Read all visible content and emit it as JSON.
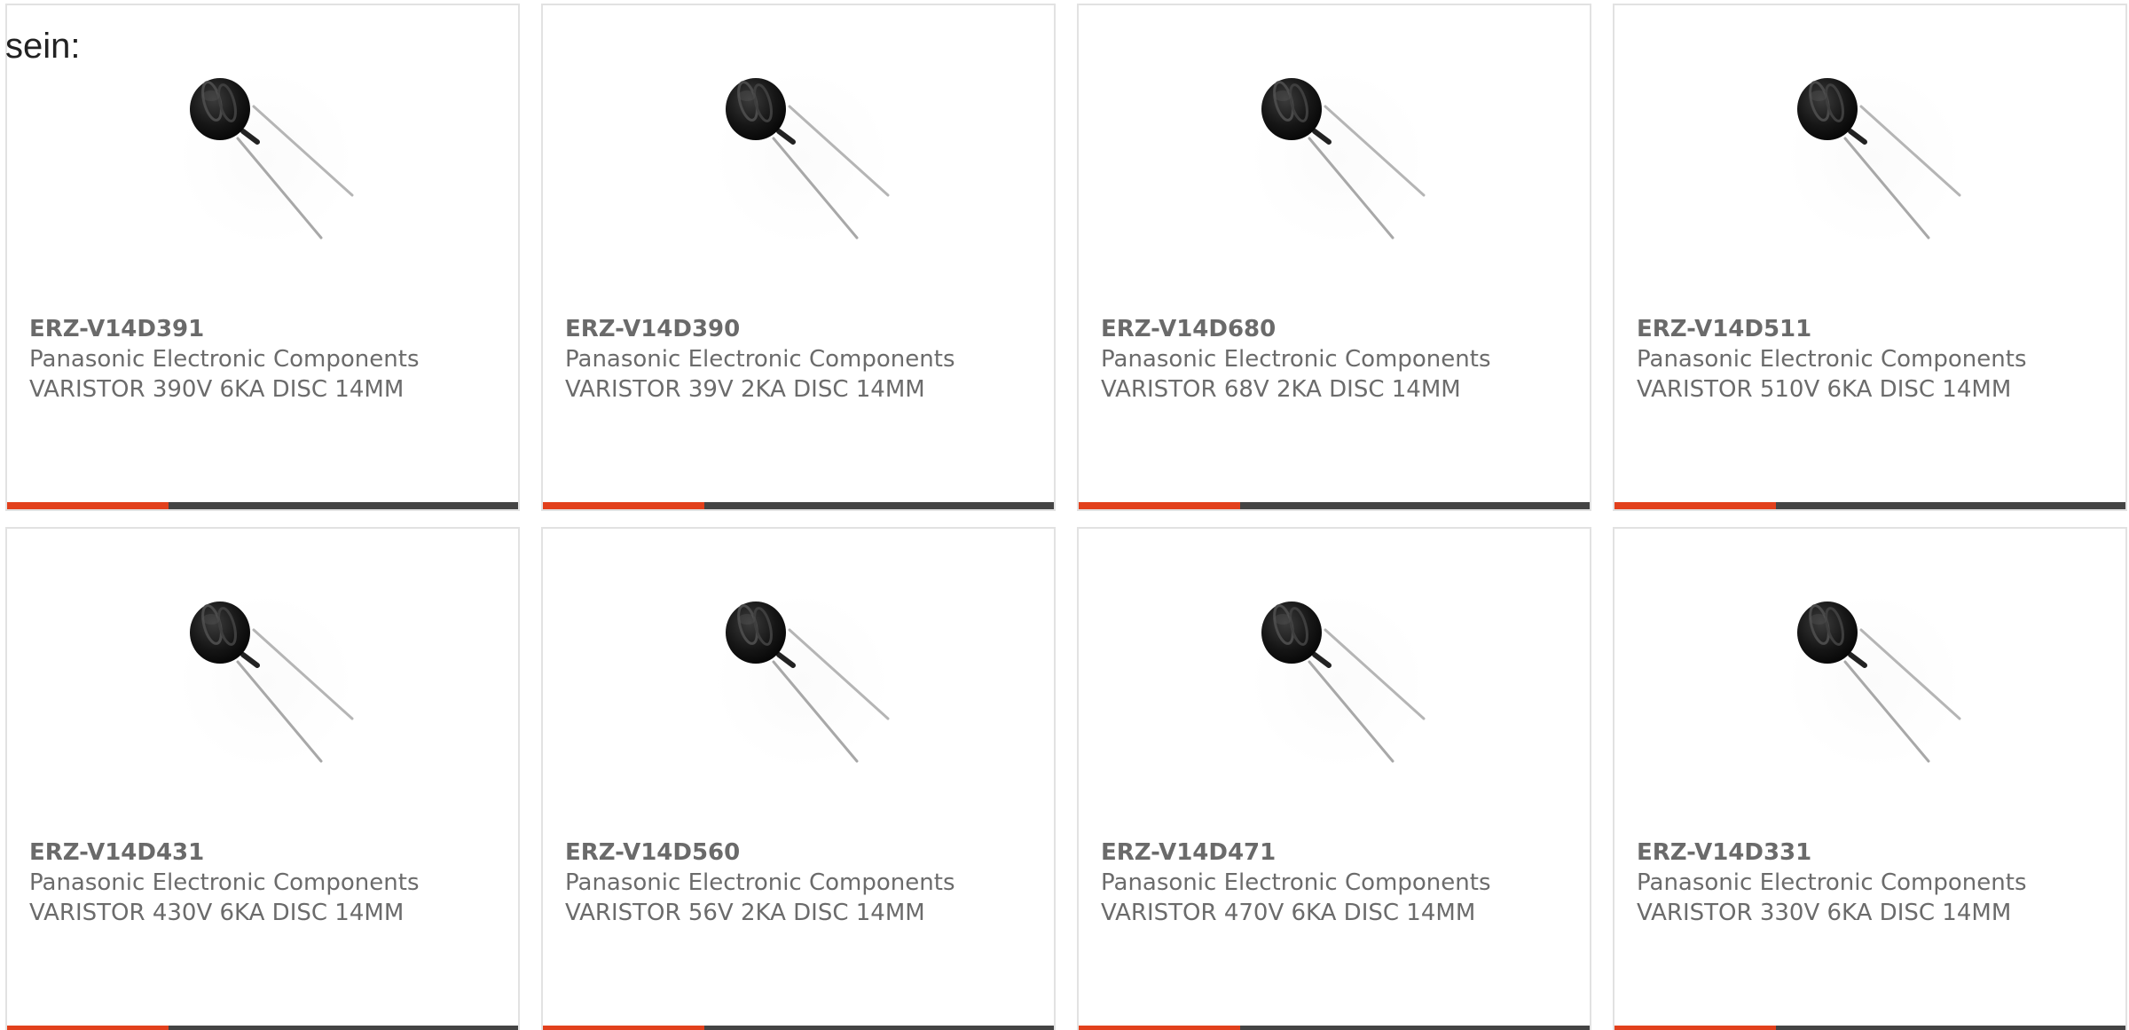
{
  "lead_text": "sein:",
  "colors": {
    "accent": "#e2401c",
    "bar": "#444444",
    "border": "#e2e2e2",
    "text": "#6b6b6b"
  },
  "products": [
    {
      "part_number": "ERZ-V14D391",
      "manufacturer": "Panasonic Electronic Components",
      "description": "VARISTOR 390V 6KA DISC 14MM",
      "image_icon": "disc-varistor-image"
    },
    {
      "part_number": "ERZ-V14D390",
      "manufacturer": "Panasonic Electronic Components",
      "description": "VARISTOR 39V 2KA DISC 14MM",
      "image_icon": "disc-varistor-image"
    },
    {
      "part_number": "ERZ-V14D680",
      "manufacturer": "Panasonic Electronic Components",
      "description": "VARISTOR 68V 2KA DISC 14MM",
      "image_icon": "disc-varistor-image"
    },
    {
      "part_number": "ERZ-V14D511",
      "manufacturer": "Panasonic Electronic Components",
      "description": "VARISTOR 510V 6KA DISC 14MM",
      "image_icon": "disc-varistor-image"
    },
    {
      "part_number": "ERZ-V14D431",
      "manufacturer": "Panasonic Electronic Components",
      "description": "VARISTOR 430V 6KA DISC 14MM",
      "image_icon": "disc-varistor-image"
    },
    {
      "part_number": "ERZ-V14D560",
      "manufacturer": "Panasonic Electronic Components",
      "description": "VARISTOR 56V 2KA DISC 14MM",
      "image_icon": "disc-varistor-image"
    },
    {
      "part_number": "ERZ-V14D471",
      "manufacturer": "Panasonic Electronic Components",
      "description": "VARISTOR 470V 6KA DISC 14MM",
      "image_icon": "disc-varistor-image"
    },
    {
      "part_number": "ERZ-V14D331",
      "manufacturer": "Panasonic Electronic Components",
      "description": "VARISTOR 330V 6KA DISC 14MM",
      "image_icon": "disc-varistor-image"
    }
  ]
}
